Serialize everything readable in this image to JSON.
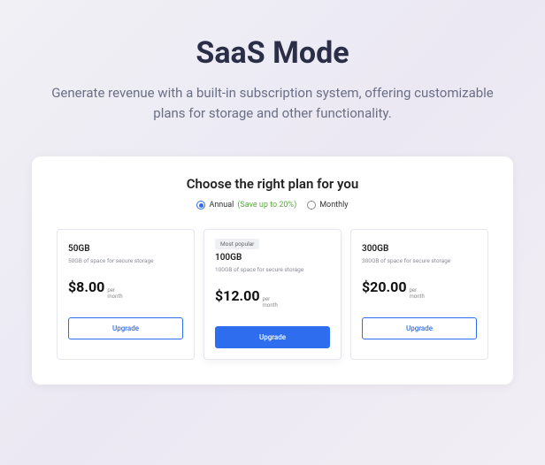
{
  "hero": {
    "title": "SaaS Mode",
    "subtitle": "Generate revenue with a built-in subscription system, offering customizable plans for storage and other functionality."
  },
  "card": {
    "title": "Choose the right plan for you",
    "toggle": {
      "annual": "Annual",
      "save": "(Save up to 20%)",
      "monthly": "Monthly"
    }
  },
  "plans": [
    {
      "name": "50GB",
      "desc": "50GB of space for secure storage",
      "price": "$8.00",
      "per1": "per",
      "per2": "month",
      "cta": "Upgrade"
    },
    {
      "badge": "Most popular",
      "name": "100GB",
      "desc": "100GB of space for secure storage",
      "price": "$12.00",
      "per1": "per",
      "per2": "month",
      "cta": "Upgrade"
    },
    {
      "name": "300GB",
      "desc": "300GB of space for secure storage",
      "price": "$20.00",
      "per1": "per",
      "per2": "month",
      "cta": "Upgrade"
    }
  ]
}
